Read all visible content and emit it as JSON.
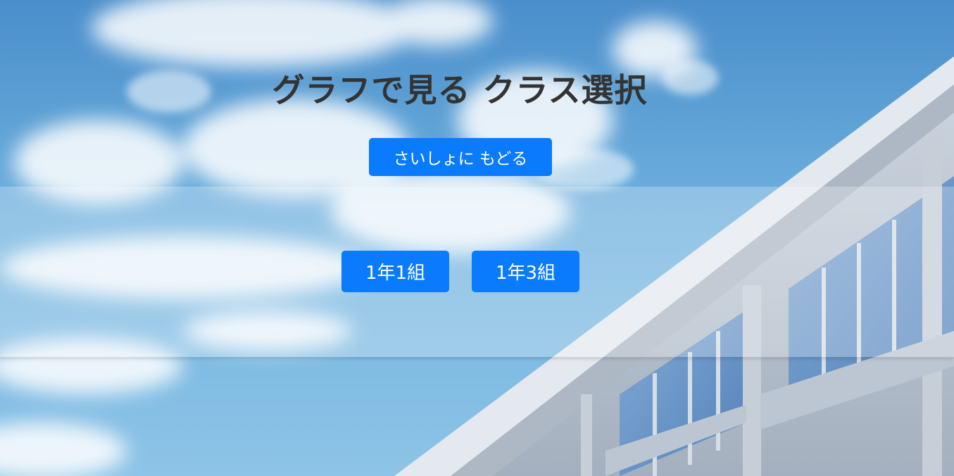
{
  "page": {
    "title": "グラフで見る クラス選択",
    "back_button_label": "さいしょに もどる"
  },
  "class_buttons": [
    {
      "label": "1年1組"
    },
    {
      "label": "1年3組"
    }
  ],
  "colors": {
    "button_bg": "#0a7bfd",
    "button_text": "#ffffff",
    "title_text": "#333333"
  }
}
